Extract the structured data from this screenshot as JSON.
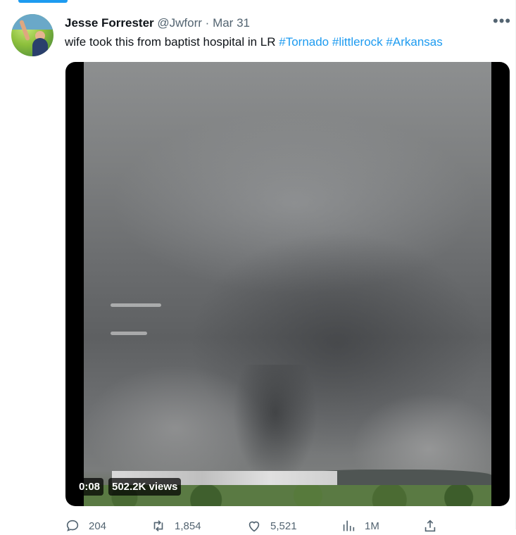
{
  "tweet": {
    "author_name": "Jesse Forrester",
    "handle": "@Jwforr",
    "separator": "·",
    "date": "Mar 31",
    "more_icon": "more-horizontal-icon",
    "text_plain": "wife took this from baptist hospital in LR ",
    "hashtags": [
      "#Tornado",
      "#littlerock",
      "#Arkansas"
    ]
  },
  "media": {
    "time": "0:08",
    "views": "502.2K views"
  },
  "actions": {
    "replies": "204",
    "retweets": "1,854",
    "likes": "5,521",
    "views": "1M"
  },
  "colors": {
    "accent": "#1d9bf0",
    "text_secondary": "#536471"
  }
}
